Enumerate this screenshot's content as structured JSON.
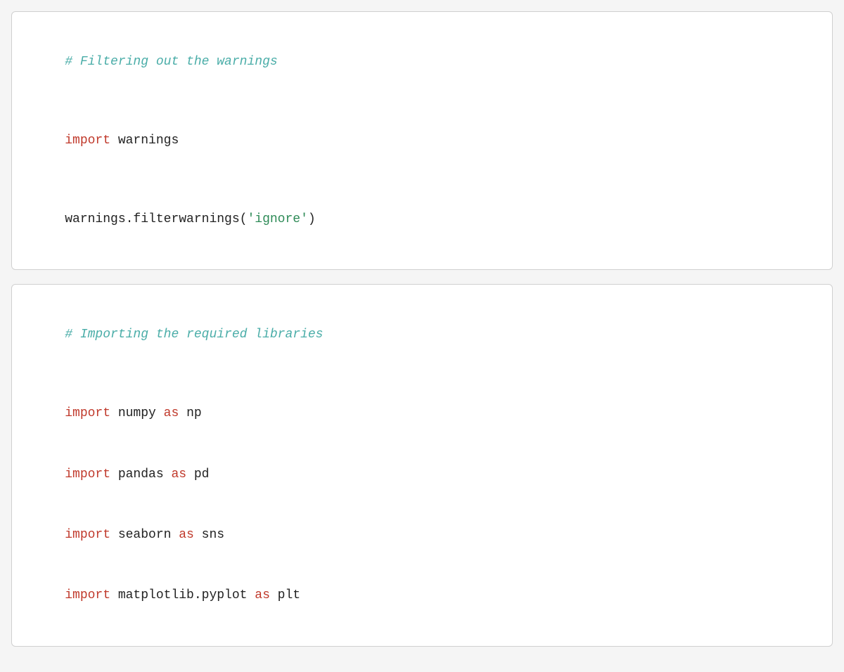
{
  "block1": {
    "comment": "# Filtering out the warnings",
    "line1_keyword": "import",
    "line1_rest": " warnings",
    "line2_normal": "warnings.filterwarnings(",
    "line2_string": "'ignore'",
    "line2_close": ")"
  },
  "block2": {
    "comment": "# Importing the required libraries",
    "imports": [
      {
        "keyword": "import",
        "module": " numpy ",
        "as_keyword": "as",
        "alias": " np"
      },
      {
        "keyword": "import",
        "module": " pandas ",
        "as_keyword": "as",
        "alias": " pd"
      },
      {
        "keyword": "import",
        "module": " seaborn ",
        "as_keyword": "as",
        "alias": " sns"
      },
      {
        "keyword": "import",
        "module": " matplotlib.pyplot ",
        "as_keyword": "as",
        "alias": " plt"
      }
    ]
  }
}
